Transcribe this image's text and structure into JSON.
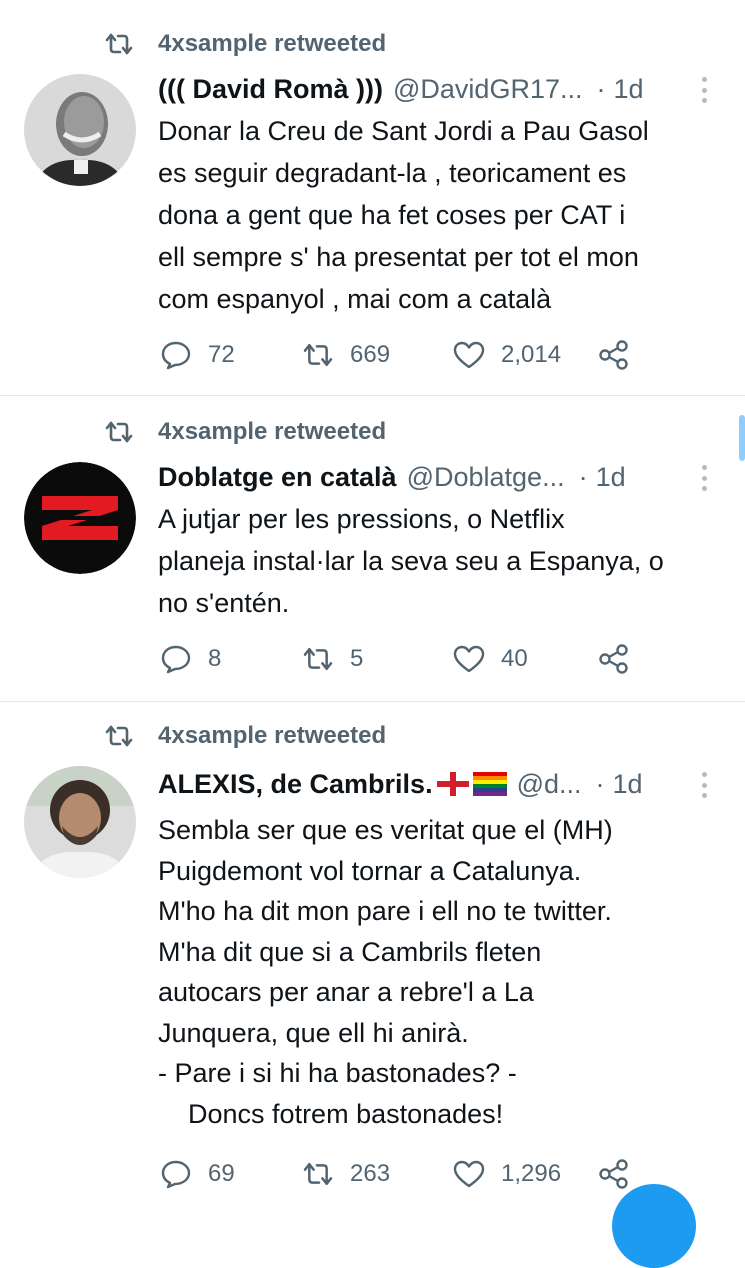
{
  "tweets": [
    {
      "retweeted_by": "4xsample retweeted",
      "name": "((( David Romà )))",
      "handle": "@DavidGR17...",
      "dot": "·",
      "time": "1d",
      "text": "Donar la Creu de Sant Jordi a Pau Gasol\nes seguir degradant-la , teoricament es\ndona a gent que ha fet coses per CAT i\nell sempre s' ha presentat per tot el mon\ncom espanyol , mai com a català",
      "replies": "72",
      "retweets": "669",
      "likes": "2,014"
    },
    {
      "retweeted_by": "4xsample retweeted",
      "name": "Doblatge en català",
      "handle": "@Doblatge...",
      "dot": "·",
      "time": "1d",
      "text": "A jutjar per les pressions, o Netflix\nplaneja instal·lar la seva seu a Espanya, o\nno s'entén.",
      "replies": "8",
      "retweets": "5",
      "likes": "40"
    },
    {
      "retweeted_by": "4xsample retweeted",
      "name": "ALEXIS, de Cambrils.",
      "handle": "@d...",
      "dot": "·",
      "time": "1d",
      "text": "Sembla ser que es veritat que el (MH)\nPuigdemont vol tornar a Catalunya.\nM'ho ha dit mon pare i ell no te twitter.\nM'ha dit que si a Cambrils fleten\nautocars per anar a rebre'l a La\nJunquera, que ell hi anirà.\n- Pare i si hi ha bastonades? -\n    Doncs fotrem bastonades!",
      "replies": "69",
      "retweets": "263",
      "likes": "1,296"
    }
  ],
  "colors": {
    "text_primary": "#0f1419",
    "text_secondary": "#536471",
    "divider": "#e7e9ea",
    "accent": "#1d9bf0"
  }
}
